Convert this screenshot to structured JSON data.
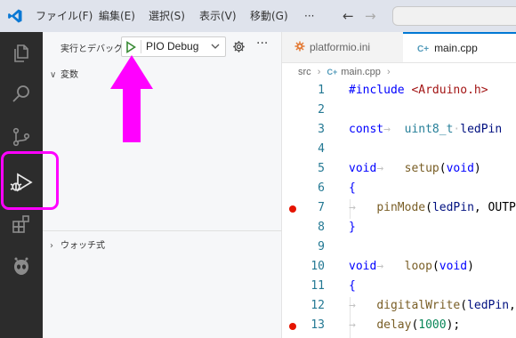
{
  "title_bar": {
    "menu": [
      "ファイル(F)",
      "編集(E)",
      "選択(S)",
      "表示(V)",
      "移動(G)"
    ],
    "more_label": "···",
    "back_label": "←",
    "forward_label": "→"
  },
  "activity_bar": {
    "items": [
      {
        "icon": "files-icon"
      },
      {
        "icon": "search-icon"
      },
      {
        "icon": "source-control-icon"
      },
      {
        "icon": "run-debug-icon",
        "active": true
      },
      {
        "icon": "extensions-icon"
      },
      {
        "icon": "platformio-alien-icon"
      }
    ]
  },
  "sidebar": {
    "title": "実行とデバッグ",
    "config_label": "PIO Debug",
    "more_label": "···",
    "variables_label": "変数",
    "watch_label": "ウォッチ式"
  },
  "annotation": {
    "color": "#ff00ff"
  },
  "tabs": [
    {
      "label": "platformio.ini",
      "active": false,
      "icon": "settings-file-icon"
    },
    {
      "label": "main.cpp",
      "active": true,
      "icon": "cpp-file-icon"
    }
  ],
  "breadcrumb": {
    "folder": "src",
    "file": "main.cpp"
  },
  "editor": {
    "lines": [
      {
        "n": "1",
        "bp": false,
        "code": [
          {
            "t": "#include ",
            "c": "kw"
          },
          {
            "t": "<Arduino.h>",
            "c": "str"
          }
        ]
      },
      {
        "n": "2",
        "bp": false,
        "code": []
      },
      {
        "n": "3",
        "bp": false,
        "code": [
          {
            "t": "const",
            "c": "kw"
          },
          {
            "t": "→  ",
            "c": "ws"
          },
          {
            "t": "uint8_t",
            "c": "ty"
          },
          {
            "t": "·",
            "c": "ws"
          },
          {
            "t": "ledPin",
            "c": "var"
          }
        ]
      },
      {
        "n": "4",
        "bp": false,
        "code": []
      },
      {
        "n": "5",
        "bp": false,
        "code": [
          {
            "t": "void",
            "c": "kw"
          },
          {
            "t": "→   ",
            "c": "ws"
          },
          {
            "t": "setup",
            "c": "fn"
          },
          {
            "t": "(",
            "c": ""
          },
          {
            "t": "void",
            "c": "kw"
          },
          {
            "t": ")",
            "c": ""
          }
        ]
      },
      {
        "n": "6",
        "bp": false,
        "code": [
          {
            "t": "{",
            "c": "kw"
          }
        ]
      },
      {
        "n": "7",
        "bp": true,
        "code": [
          {
            "t": "→   ",
            "c": "ws"
          },
          {
            "t": "pinMode",
            "c": "fn"
          },
          {
            "t": "(",
            "c": ""
          },
          {
            "t": "ledPin",
            "c": "var"
          },
          {
            "t": ", OUTPUT);",
            "c": ""
          }
        ]
      },
      {
        "n": "8",
        "bp": false,
        "code": [
          {
            "t": "}",
            "c": "kw"
          }
        ]
      },
      {
        "n": "9",
        "bp": false,
        "code": []
      },
      {
        "n": "10",
        "bp": false,
        "code": [
          {
            "t": "void",
            "c": "kw"
          },
          {
            "t": "→   ",
            "c": "ws"
          },
          {
            "t": "loop",
            "c": "fn"
          },
          {
            "t": "(",
            "c": ""
          },
          {
            "t": "void",
            "c": "kw"
          },
          {
            "t": ")",
            "c": ""
          }
        ]
      },
      {
        "n": "11",
        "bp": false,
        "code": [
          {
            "t": "{",
            "c": "kw"
          }
        ]
      },
      {
        "n": "12",
        "bp": false,
        "code": [
          {
            "t": "→   ",
            "c": "ws"
          },
          {
            "t": "digitalWrite",
            "c": "fn"
          },
          {
            "t": "(",
            "c": ""
          },
          {
            "t": "ledPin",
            "c": "var"
          },
          {
            "t": ", HIGH);",
            "c": ""
          }
        ]
      },
      {
        "n": "13",
        "bp": true,
        "code": [
          {
            "t": "→   ",
            "c": "ws"
          },
          {
            "t": "delay",
            "c": "fn"
          },
          {
            "t": "(",
            "c": ""
          },
          {
            "t": "1000",
            "c": "num"
          },
          {
            "t": ");",
            "c": ""
          }
        ]
      }
    ]
  }
}
